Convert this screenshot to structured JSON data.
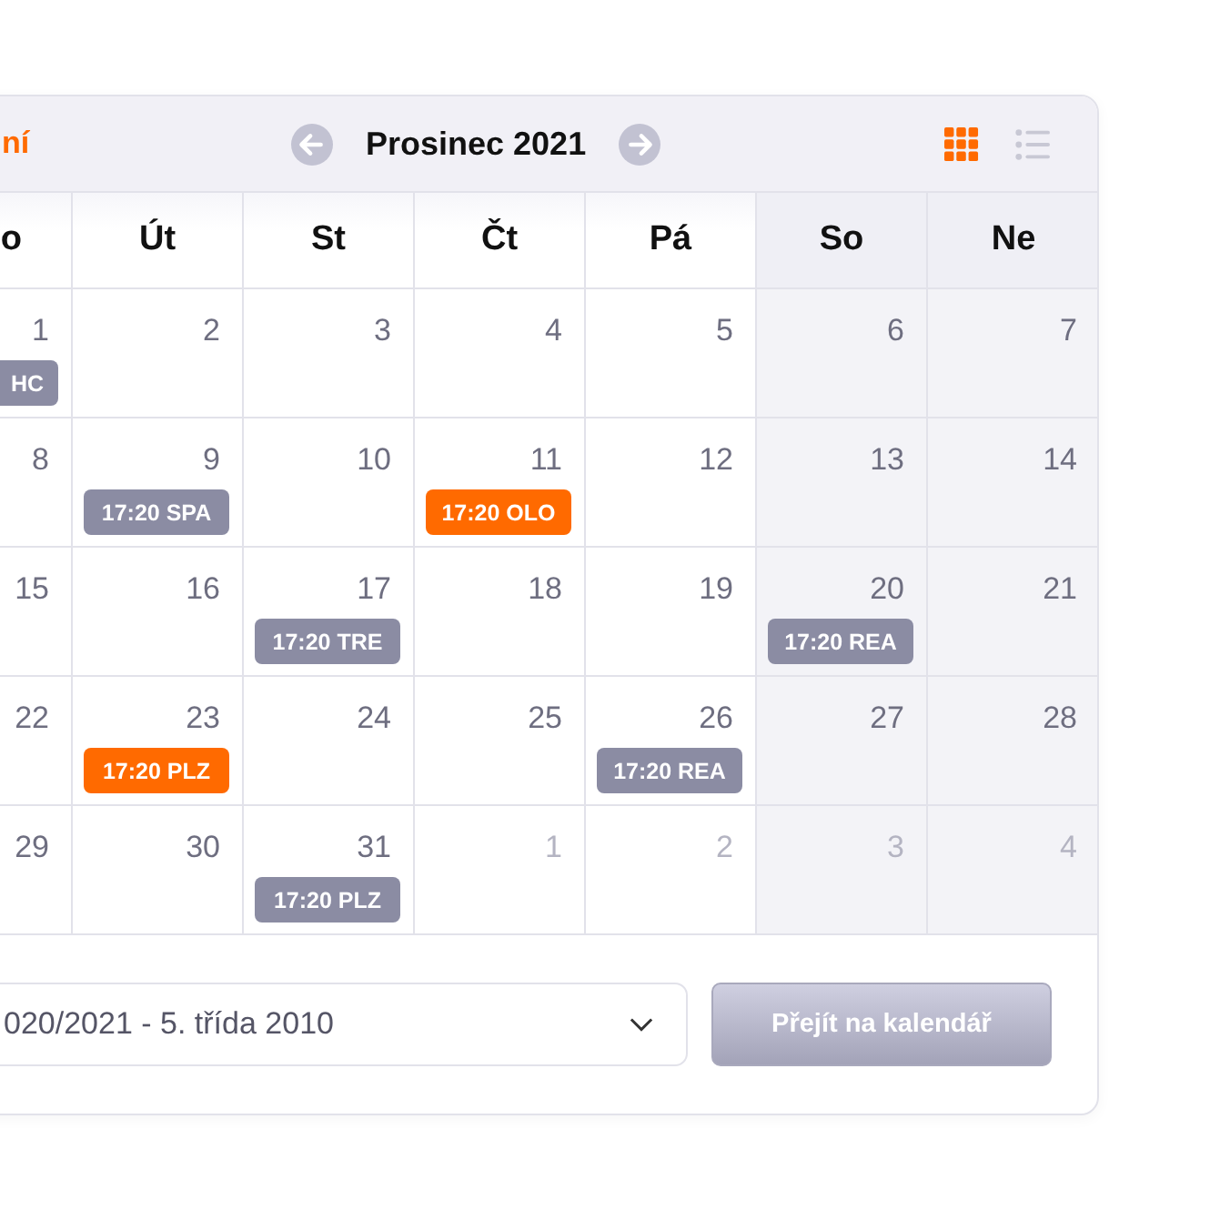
{
  "header": {
    "left_label": "ní",
    "month": "Prosinec 2021",
    "view_modes": [
      {
        "selected": true
      },
      {
        "selected": false
      }
    ]
  },
  "weekdays": [
    {
      "label": "o",
      "weekend": false
    },
    {
      "label": "Út",
      "weekend": false
    },
    {
      "label": "St",
      "weekend": false
    },
    {
      "label": "Čt",
      "weekend": false
    },
    {
      "label": "Pá",
      "weekend": false
    },
    {
      "label": "So",
      "weekend": true
    },
    {
      "label": "Ne",
      "weekend": true
    }
  ],
  "weeks": [
    [
      {
        "day": "1",
        "other_month": false,
        "event": {
          "label": "HC",
          "color": "#8b8ca3"
        }
      },
      {
        "day": "2",
        "other_month": false
      },
      {
        "day": "3",
        "other_month": false
      },
      {
        "day": "4",
        "other_month": false
      },
      {
        "day": "5",
        "other_month": false
      },
      {
        "day": "6",
        "other_month": false
      },
      {
        "day": "7",
        "other_month": false
      }
    ],
    [
      {
        "day": "8",
        "other_month": false
      },
      {
        "day": "9",
        "other_month": false,
        "event": {
          "label": "17:20 SPA",
          "color": "#8b8ca3"
        }
      },
      {
        "day": "10",
        "other_month": false
      },
      {
        "day": "11",
        "other_month": false,
        "event": {
          "label": "17:20 OLO",
          "color": "#ff6a00"
        }
      },
      {
        "day": "12",
        "other_month": false
      },
      {
        "day": "13",
        "other_month": false
      },
      {
        "day": "14",
        "other_month": false
      }
    ],
    [
      {
        "day": "15",
        "other_month": false
      },
      {
        "day": "16",
        "other_month": false
      },
      {
        "day": "17",
        "other_month": false,
        "event": {
          "label": "17:20 TRE",
          "color": "#8b8ca3"
        }
      },
      {
        "day": "18",
        "other_month": false
      },
      {
        "day": "19",
        "other_month": false
      },
      {
        "day": "20",
        "other_month": false,
        "event": {
          "label": "17:20 REA",
          "color": "#8b8ca3"
        }
      },
      {
        "day": "21",
        "other_month": false
      }
    ],
    [
      {
        "day": "22",
        "other_month": false
      },
      {
        "day": "23",
        "other_month": false,
        "event": {
          "label": "17:20 PLZ",
          "color": "#ff6a00"
        }
      },
      {
        "day": "24",
        "other_month": false
      },
      {
        "day": "25",
        "other_month": false
      },
      {
        "day": "26",
        "other_month": false,
        "event": {
          "label": "17:20 REA",
          "color": "#8b8ca3"
        }
      },
      {
        "day": "27",
        "other_month": false
      },
      {
        "day": "28",
        "other_month": false
      }
    ],
    [
      {
        "day": "29",
        "other_month": false
      },
      {
        "day": "30",
        "other_month": false
      },
      {
        "day": "31",
        "other_month": false,
        "event": {
          "label": "17:20 PLZ",
          "color": "#8b8ca3"
        }
      },
      {
        "day": "1",
        "other_month": true
      },
      {
        "day": "2",
        "other_month": true
      },
      {
        "day": "3",
        "other_month": true
      },
      {
        "day": "4",
        "other_month": true
      }
    ]
  ],
  "footer": {
    "class_select": "020/2021 - 5. třída 2010",
    "button": "Přejít na kalendář"
  }
}
